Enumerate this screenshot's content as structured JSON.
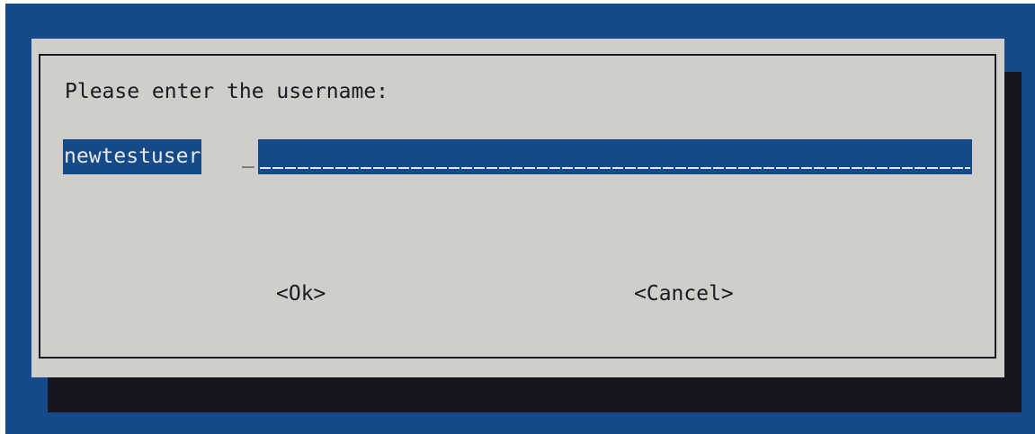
{
  "dialog": {
    "prompt": "Please enter the username:",
    "input": {
      "value": "newtestuser",
      "cursor": "_"
    },
    "buttons": {
      "ok_label": "<Ok>",
      "cancel_label": "<Cancel>"
    }
  },
  "colors": {
    "background": "#154a8a",
    "dialog": "#cfcecb",
    "shadow": "#17151e",
    "input_fill": "#154a8a",
    "text": "#1a1a1f"
  }
}
